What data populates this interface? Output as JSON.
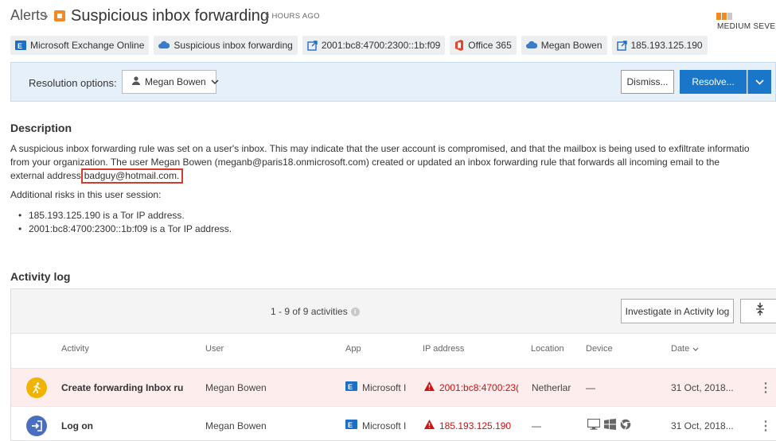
{
  "header": {
    "breadcrumb": "Alerts",
    "breadcrumb_sep": "›",
    "title": "Suspicious inbox forwarding",
    "age": "3 HOURS AGO",
    "severity": "MEDIUM SEVER",
    "alert_color": "#f08a24",
    "severity_colors": [
      "#f08a24",
      "#f08a24",
      "#c8c8c8"
    ]
  },
  "entities": [
    {
      "label": "Microsoft Exchange Online",
      "icon": "exchange-icon"
    },
    {
      "label": "Suspicious inbox forwarding",
      "icon": "cloud-rule-icon"
    },
    {
      "label": "2001:bc8:4700:2300::1b:f09",
      "icon": "external-link-icon"
    },
    {
      "label": "Office 365",
      "icon": "office-icon"
    },
    {
      "label": "Megan Bowen",
      "icon": "cloud-user-icon"
    },
    {
      "label": "185.193.125.190",
      "icon": "external-link-icon"
    }
  ],
  "resolution": {
    "label": "Resolution options:",
    "user": "Megan Bowen",
    "dismiss": "Dismiss...",
    "resolve": "Resolve..."
  },
  "description": {
    "heading": "Description",
    "line1": "A suspicious inbox forwarding rule was set on a user's inbox. This may indicate that the user account is compromised, and that the mailbox is being used to exfiltrate informatio",
    "line2": "from your organization. The user Megan Bowen (meganb@paris18.onmicrosoft.com) created or updated an inbox forwarding rule that forwards all incoming email to the",
    "line3_prefix": "external address",
    "line3_highlight": " badguy@hotmail.com.",
    "additional": "Additional risks in this user session:",
    "risks": [
      "185.193.125.190 is a Tor IP address.",
      "2001:bc8:4700:2300::1b:f09 is a Tor IP address."
    ]
  },
  "activity_log": {
    "heading": "Activity log",
    "count": "1 - 9 of 9 activities",
    "investigate": "Investigate in Activity log",
    "columns": [
      "Activity",
      "User",
      "App",
      "IP address",
      "Location",
      "Device",
      "Date"
    ],
    "date_sort_icon": "chevron-down-icon",
    "rows": [
      {
        "activity": "Create forwarding Inbox ru",
        "user": "Megan Bowen",
        "app": "Microsoft I",
        "ip": "2001:bc8:4700:23(",
        "location": "Netherlar",
        "device": "—",
        "date": "31 Oct, 2018...",
        "icon_color": "#f0b400"
      },
      {
        "activity": "Log on",
        "user": "Megan Bowen",
        "app": "Microsoft I",
        "ip": "185.193.125.190",
        "location": "—",
        "device": "",
        "date": "31 Oct, 2018...",
        "icon_color": "#4a6fc0"
      }
    ]
  },
  "colors": {
    "accent": "#1976c8",
    "danger": "#d43b2e",
    "resolution_bg": "#e5f0fb",
    "highlight_row": "#fdeded"
  }
}
